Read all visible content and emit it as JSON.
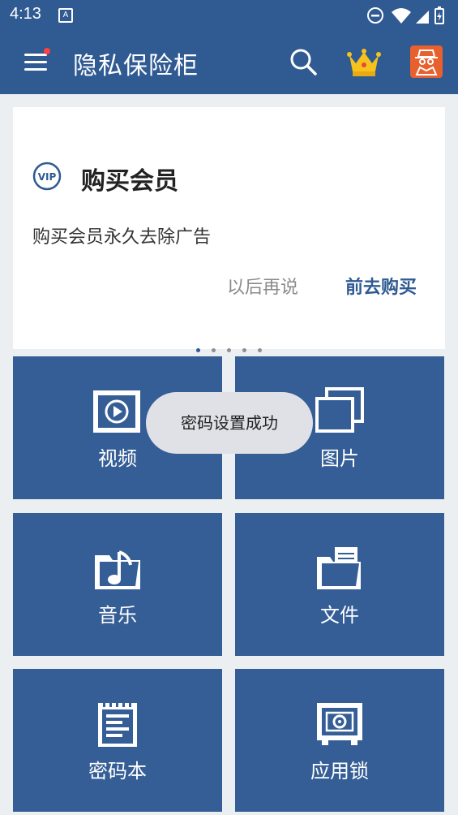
{
  "status": {
    "time": "4:13",
    "a_badge": "A"
  },
  "appbar": {
    "title": "隐私保险柜"
  },
  "card": {
    "title": "购买会员",
    "desc": "购买会员永久去除广告",
    "later": "以后再说",
    "buy": "前去购买",
    "vip_text": "VIP"
  },
  "tiles": {
    "video": "视频",
    "image": "图片",
    "music": "音乐",
    "file": "文件",
    "notes": "密码本",
    "applock": "应用锁"
  },
  "toast": "密码设置成功",
  "colors": {
    "primary": "#2f5a92",
    "tile": "#355e96",
    "accent": "#e8602d"
  }
}
